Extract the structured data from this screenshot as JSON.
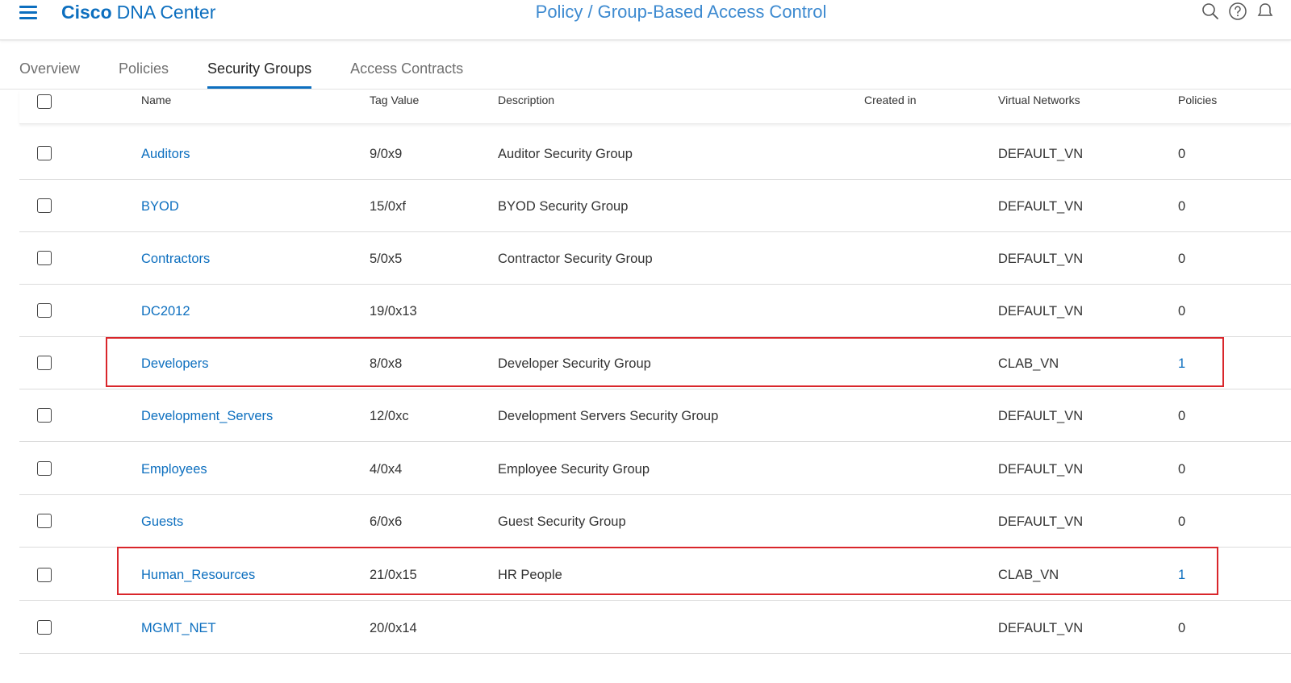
{
  "header": {
    "brand_strong": "Cisco",
    "brand_light": "DNA Center",
    "title": "Policy  /  Group-Based Access Control",
    "icons": [
      "menu-icon",
      "search-icon",
      "help-icon",
      "notification-icon"
    ]
  },
  "tabs": [
    {
      "label": "Overview",
      "active": false
    },
    {
      "label": "Policies",
      "active": false
    },
    {
      "label": "Security Groups",
      "active": true
    },
    {
      "label": "Access Contracts",
      "active": false
    }
  ],
  "table": {
    "columns": {
      "name": "Name",
      "tag_value": "Tag Value",
      "description": "Description",
      "created_in": "Created in",
      "virtual_networks": "Virtual Networks",
      "policies": "Policies"
    },
    "rows": [
      {
        "name": "Auditors",
        "tag_value": "9/0x9",
        "description": "Auditor Security Group",
        "created_in": "",
        "virtual_networks": "DEFAULT_VN",
        "policies": "0",
        "highlighted": false
      },
      {
        "name": "BYOD",
        "tag_value": "15/0xf",
        "description": "BYOD Security Group",
        "created_in": "",
        "virtual_networks": "DEFAULT_VN",
        "policies": "0",
        "highlighted": false
      },
      {
        "name": "Contractors",
        "tag_value": "5/0x5",
        "description": "Contractor Security Group",
        "created_in": "",
        "virtual_networks": "DEFAULT_VN",
        "policies": "0",
        "highlighted": false
      },
      {
        "name": "DC2012",
        "tag_value": "19/0x13",
        "description": "",
        "created_in": "",
        "virtual_networks": "DEFAULT_VN",
        "policies": "0",
        "highlighted": false
      },
      {
        "name": "Developers",
        "tag_value": "8/0x8",
        "description": "Developer Security Group",
        "created_in": "",
        "virtual_networks": "CLAB_VN",
        "policies": "1",
        "highlighted": true
      },
      {
        "name": "Development_Servers",
        "tag_value": "12/0xc",
        "description": "Development Servers Security Group",
        "created_in": "",
        "virtual_networks": "DEFAULT_VN",
        "policies": "0",
        "highlighted": false
      },
      {
        "name": "Employees",
        "tag_value": "4/0x4",
        "description": "Employee Security Group",
        "created_in": "",
        "virtual_networks": "DEFAULT_VN",
        "policies": "0",
        "highlighted": false
      },
      {
        "name": "Guests",
        "tag_value": "6/0x6",
        "description": "Guest Security Group",
        "created_in": "",
        "virtual_networks": "DEFAULT_VN",
        "policies": "0",
        "highlighted": false
      },
      {
        "name": "Human_Resources",
        "tag_value": "21/0x15",
        "description": "HR People",
        "created_in": "",
        "virtual_networks": "CLAB_VN",
        "policies": "1",
        "highlighted": true
      },
      {
        "name": "MGMT_NET",
        "tag_value": "20/0x14",
        "description": "",
        "created_in": "",
        "virtual_networks": "DEFAULT_VN",
        "policies": "0",
        "highlighted": false
      }
    ]
  },
  "colors": {
    "brand_blue": "#0d6fbf",
    "title_blue": "#3d8ad0",
    "highlight_red": "#d9262b"
  }
}
